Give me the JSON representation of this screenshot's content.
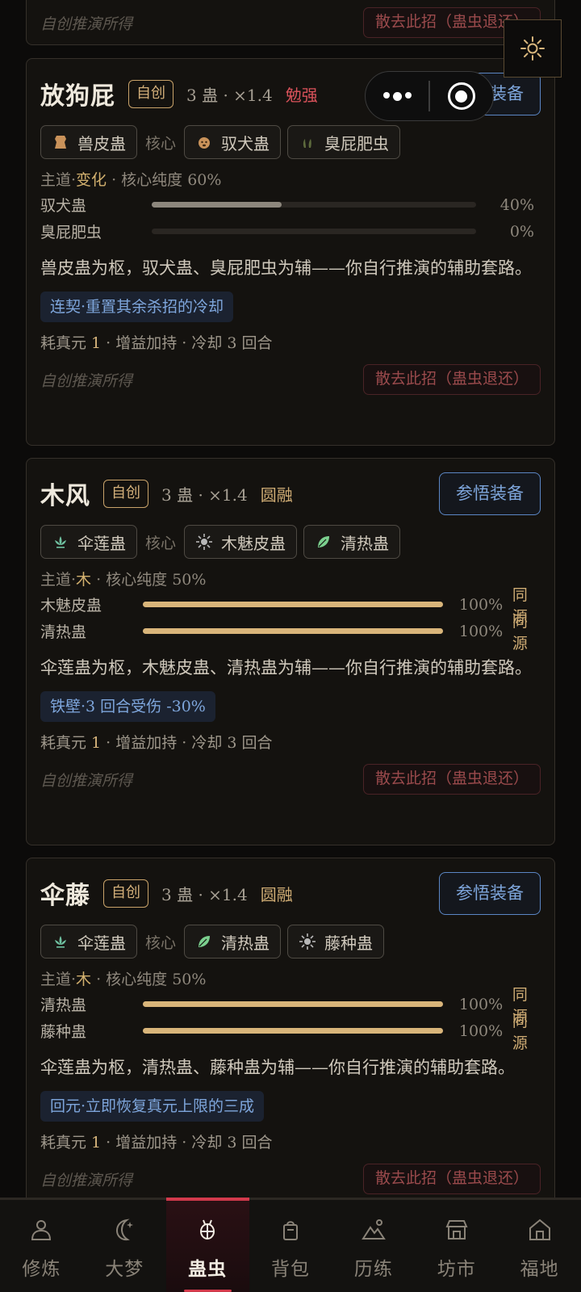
{
  "top_card": {
    "source_label": "自创推演所得",
    "dismiss_label": "散去此招（蛊虫退还）"
  },
  "cards": [
    {
      "name": "放狗屁",
      "badge": "自创",
      "stats": "3 蛊 · ×1.4",
      "grade": "勉强",
      "grade_color": "#d9525a",
      "equip_label": "参悟装备",
      "chips": [
        {
          "icon": "leather-icon",
          "label": "兽皮蛊"
        },
        {
          "icon": "dog-face-icon",
          "label": "驭犬蛊"
        },
        {
          "icon": "bug-icon",
          "label": "臭屁肥虫"
        }
      ],
      "core_label": "核心",
      "path_prefix": "主道·",
      "path_element": "变化",
      "path_suffix": " · 核心纯度 60%",
      "bars": [
        {
          "name": "驭犬蛊",
          "pct": "40%",
          "value": 0.4,
          "same": ""
        },
        {
          "name": "臭屁肥虫",
          "pct": "0%",
          "value": 0.0,
          "same": ""
        }
      ],
      "desc": "兽皮蛊为枢，驭犬蛊、臭屁肥虫为辅——你自行推演的辅助套路。",
      "effect": "连契·重置其余杀招的冷却",
      "cost_prefix": "耗真元 ",
      "cost_num": "1",
      "cost_suffix": " · 增益加持 · 冷却 3 回合",
      "source_label": "自创推演所得",
      "dismiss_label": "散去此招（蛊虫退还）"
    },
    {
      "name": "木风",
      "badge": "自创",
      "stats": "3 蛊 · ×1.4",
      "grade": "圆融",
      "grade_color": "#cfac74",
      "equip_label": "参悟装备",
      "chips": [
        {
          "icon": "lotus-icon",
          "label": "伞莲蛊"
        },
        {
          "icon": "sun-spike-icon",
          "label": "木魅皮蛊"
        },
        {
          "icon": "leaf-icon",
          "label": "清热蛊"
        }
      ],
      "core_label": "核心",
      "path_prefix": "主道·",
      "path_element": "木",
      "path_suffix": " · 核心纯度 50%",
      "bars": [
        {
          "name": "木魅皮蛊",
          "pct": "100%",
          "value": 1.0,
          "same": "同源"
        },
        {
          "name": "清热蛊",
          "pct": "100%",
          "value": 1.0,
          "same": "同源"
        }
      ],
      "desc": "伞莲蛊为枢，木魅皮蛊、清热蛊为辅——你自行推演的辅助套路。",
      "effect": "铁壁·3 回合受伤 -30%",
      "cost_prefix": "耗真元 ",
      "cost_num": "1",
      "cost_suffix": " · 增益加持 · 冷却 3 回合",
      "source_label": "自创推演所得",
      "dismiss_label": "散去此招（蛊虫退还）"
    },
    {
      "name": "伞藤",
      "badge": "自创",
      "stats": "3 蛊 · ×1.4",
      "grade": "圆融",
      "grade_color": "#cfac74",
      "equip_label": "参悟装备",
      "chips": [
        {
          "icon": "lotus-icon",
          "label": "伞莲蛊"
        },
        {
          "icon": "leaf-icon",
          "label": "清热蛊"
        },
        {
          "icon": "sun-spike-icon",
          "label": "藤种蛊"
        }
      ],
      "core_label": "核心",
      "path_prefix": "主道·",
      "path_element": "木",
      "path_suffix": " · 核心纯度 50%",
      "bars": [
        {
          "name": "清热蛊",
          "pct": "100%",
          "value": 1.0,
          "same": "同源"
        },
        {
          "name": "藤种蛊",
          "pct": "100%",
          "value": 1.0,
          "same": "同源"
        }
      ],
      "desc": "伞莲蛊为枢，清热蛊、藤种蛊为辅——你自行推演的辅助套路。",
      "effect": "回元·立即恢复真元上限的三成",
      "cost_prefix": "耗真元 ",
      "cost_num": "1",
      "cost_suffix": " · 增益加持 · 冷却 3 回合",
      "source_label": "自创推演所得",
      "dismiss_label": "散去此招（蛊虫退还）"
    }
  ],
  "tabs": [
    {
      "label": "修炼",
      "icon": "person-icon",
      "active": false
    },
    {
      "label": "大梦",
      "icon": "moon-icon",
      "active": false
    },
    {
      "label": "蛊虫",
      "icon": "gu-bug-icon",
      "active": true
    },
    {
      "label": "背包",
      "icon": "bag-icon",
      "active": false
    },
    {
      "label": "历练",
      "icon": "mountain-icon",
      "active": false
    },
    {
      "label": "坊市",
      "icon": "shop-icon",
      "active": false
    },
    {
      "label": "福地",
      "icon": "home-icon",
      "active": false
    }
  ],
  "overlay": {
    "more_icon": "more-dots-icon",
    "close_icon": "target-close-icon",
    "settings_icon": "sun-gear-icon"
  }
}
